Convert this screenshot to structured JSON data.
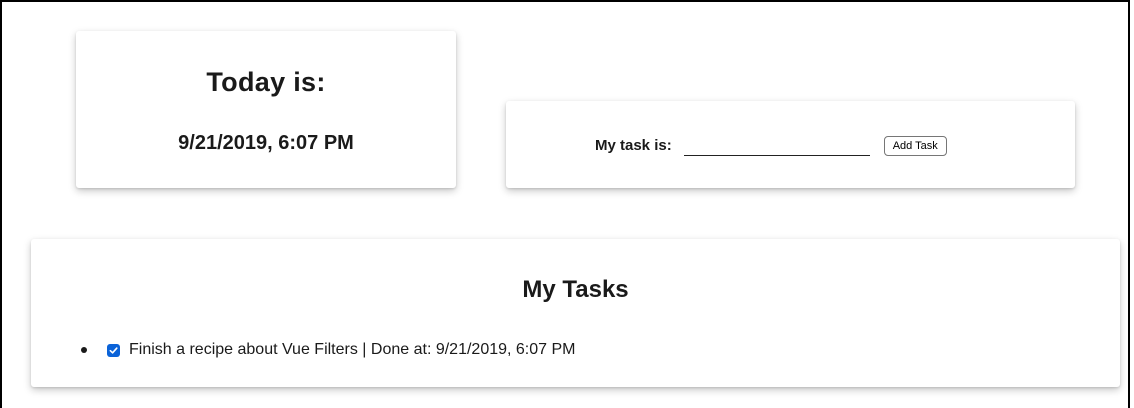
{
  "date_card": {
    "title": "Today is:",
    "date": "9/21/2019, 6:07 PM"
  },
  "task_card": {
    "label": "My task is:",
    "input_value": "",
    "button_label": "Add Task"
  },
  "list_card": {
    "title": "My Tasks",
    "tasks": [
      {
        "text": "Finish a recipe about Vue Filters | Done at: 9/21/2019, 6:07 PM",
        "checked": true
      }
    ]
  },
  "colors": {
    "checkbox": "#0b63d8",
    "text": "#1a1a1a",
    "background": "#ffffff"
  }
}
